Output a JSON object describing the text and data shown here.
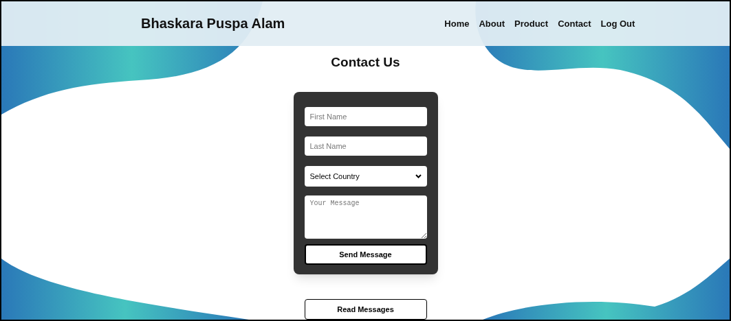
{
  "header": {
    "brand": "Bhaskara Puspa Alam",
    "nav": [
      {
        "label": "Home"
      },
      {
        "label": "About"
      },
      {
        "label": "Product"
      },
      {
        "label": "Contact"
      },
      {
        "label": "Log Out"
      }
    ]
  },
  "title": "Contact Us",
  "form": {
    "first_name": {
      "placeholder": "First Name"
    },
    "last_name": {
      "placeholder": "Last Name"
    },
    "country": {
      "value": "Select Country"
    },
    "message": {
      "placeholder": "Your Message"
    },
    "submit": "Send Message"
  },
  "read_button": "Read Messages"
}
